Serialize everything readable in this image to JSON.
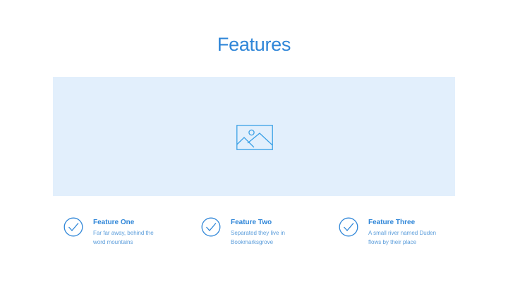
{
  "page": {
    "title": "Features"
  },
  "hero": {
    "icon": "image-placeholder-icon",
    "background_color": "#e2effc",
    "icon_color": "#3aa0e6"
  },
  "features": [
    {
      "icon": "check-circle-icon",
      "title": "Feature One",
      "desc_line1": "Far far away, behind the",
      "desc_line2": "word mountains"
    },
    {
      "icon": "check-circle-icon",
      "title": "Feature Two",
      "desc_line1": "Separated they live in",
      "desc_line2": "Bookmarksgrove"
    },
    {
      "icon": "check-circle-icon",
      "title": "Feature Three",
      "desc_line1": "A small river named Duden",
      "desc_line2": "flows by their place"
    }
  ],
  "colors": {
    "accent": "#2f86d8",
    "muted_text": "#5b9ddb"
  }
}
